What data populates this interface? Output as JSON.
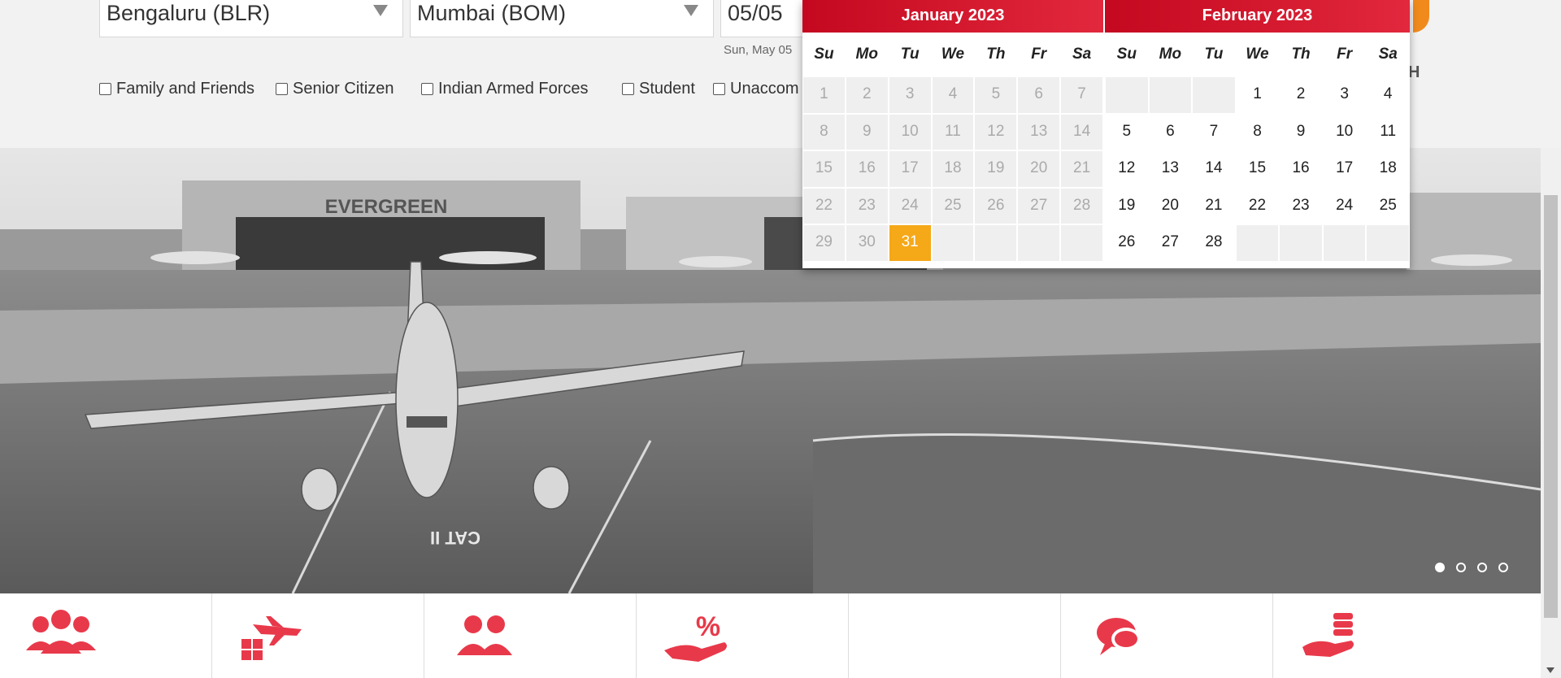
{
  "search": {
    "origin": "Bengaluru (BLR)",
    "destination": "Mumbai (BOM)",
    "date_value": "05/05",
    "date_hint": "Sun, May 05"
  },
  "options": [
    {
      "label": "Family and Friends"
    },
    {
      "label": "Senior Citizen"
    },
    {
      "label": "Indian Armed Forces"
    },
    {
      "label": "Student"
    },
    {
      "label": "Unaccom"
    }
  ],
  "brand_partial_letter": "H",
  "calendar": {
    "weekdays": [
      "Su",
      "Mo",
      "Tu",
      "We",
      "Th",
      "Fr",
      "Sa"
    ],
    "months": [
      {
        "title": "January 2023",
        "cells": [
          {
            "d": "1",
            "s": "past"
          },
          {
            "d": "2",
            "s": "past"
          },
          {
            "d": "3",
            "s": "past"
          },
          {
            "d": "4",
            "s": "past"
          },
          {
            "d": "5",
            "s": "past"
          },
          {
            "d": "6",
            "s": "past"
          },
          {
            "d": "7",
            "s": "past"
          },
          {
            "d": "8",
            "s": "past"
          },
          {
            "d": "9",
            "s": "past"
          },
          {
            "d": "10",
            "s": "past"
          },
          {
            "d": "11",
            "s": "past"
          },
          {
            "d": "12",
            "s": "past"
          },
          {
            "d": "13",
            "s": "past"
          },
          {
            "d": "14",
            "s": "past"
          },
          {
            "d": "15",
            "s": "past"
          },
          {
            "d": "16",
            "s": "past"
          },
          {
            "d": "17",
            "s": "past"
          },
          {
            "d": "18",
            "s": "past"
          },
          {
            "d": "19",
            "s": "past"
          },
          {
            "d": "20",
            "s": "past"
          },
          {
            "d": "21",
            "s": "past"
          },
          {
            "d": "22",
            "s": "past"
          },
          {
            "d": "23",
            "s": "past"
          },
          {
            "d": "24",
            "s": "past"
          },
          {
            "d": "25",
            "s": "past"
          },
          {
            "d": "26",
            "s": "past"
          },
          {
            "d": "27",
            "s": "past"
          },
          {
            "d": "28",
            "s": "past"
          },
          {
            "d": "29",
            "s": "past"
          },
          {
            "d": "30",
            "s": "past"
          },
          {
            "d": "31",
            "s": "sel"
          },
          {
            "d": "",
            "s": "empty"
          },
          {
            "d": "",
            "s": "empty"
          },
          {
            "d": "",
            "s": "empty"
          },
          {
            "d": "",
            "s": "empty"
          }
        ]
      },
      {
        "title": "February 2023",
        "cells": [
          {
            "d": "",
            "s": "empty"
          },
          {
            "d": "",
            "s": "empty"
          },
          {
            "d": "",
            "s": "empty"
          },
          {
            "d": "1",
            "s": "avail"
          },
          {
            "d": "2",
            "s": "avail"
          },
          {
            "d": "3",
            "s": "avail"
          },
          {
            "d": "4",
            "s": "avail"
          },
          {
            "d": "5",
            "s": "avail"
          },
          {
            "d": "6",
            "s": "avail"
          },
          {
            "d": "7",
            "s": "avail"
          },
          {
            "d": "8",
            "s": "avail"
          },
          {
            "d": "9",
            "s": "avail"
          },
          {
            "d": "10",
            "s": "avail"
          },
          {
            "d": "11",
            "s": "avail"
          },
          {
            "d": "12",
            "s": "avail"
          },
          {
            "d": "13",
            "s": "avail"
          },
          {
            "d": "14",
            "s": "avail"
          },
          {
            "d": "15",
            "s": "avail"
          },
          {
            "d": "16",
            "s": "avail"
          },
          {
            "d": "17",
            "s": "avail"
          },
          {
            "d": "18",
            "s": "avail"
          },
          {
            "d": "19",
            "s": "avail"
          },
          {
            "d": "20",
            "s": "avail"
          },
          {
            "d": "21",
            "s": "avail"
          },
          {
            "d": "22",
            "s": "avail"
          },
          {
            "d": "23",
            "s": "avail"
          },
          {
            "d": "24",
            "s": "avail"
          },
          {
            "d": "25",
            "s": "avail"
          },
          {
            "d": "26",
            "s": "avail"
          },
          {
            "d": "27",
            "s": "avail"
          },
          {
            "d": "28",
            "s": "avail"
          },
          {
            "d": "",
            "s": "empty"
          },
          {
            "d": "",
            "s": "empty"
          },
          {
            "d": "",
            "s": "empty"
          },
          {
            "d": "",
            "s": "empty"
          }
        ]
      }
    ]
  },
  "hero": {
    "hangar_sign": "EVERGREEN",
    "runway_marking": "CAT II",
    "slides": 4,
    "active_slide": 1
  },
  "services": [
    {
      "icon": "group-icon"
    },
    {
      "icon": "flight-baggage-icon"
    },
    {
      "icon": "support-agents-icon"
    },
    {
      "icon": "discount-hand-icon"
    },
    {
      "icon": "blank"
    },
    {
      "icon": "chat-icon"
    },
    {
      "icon": "payment-hand-icon"
    }
  ],
  "colors": {
    "accent_red": "#d7102a",
    "selected_day": "#f5a818",
    "service_icon": "#e8394a"
  }
}
